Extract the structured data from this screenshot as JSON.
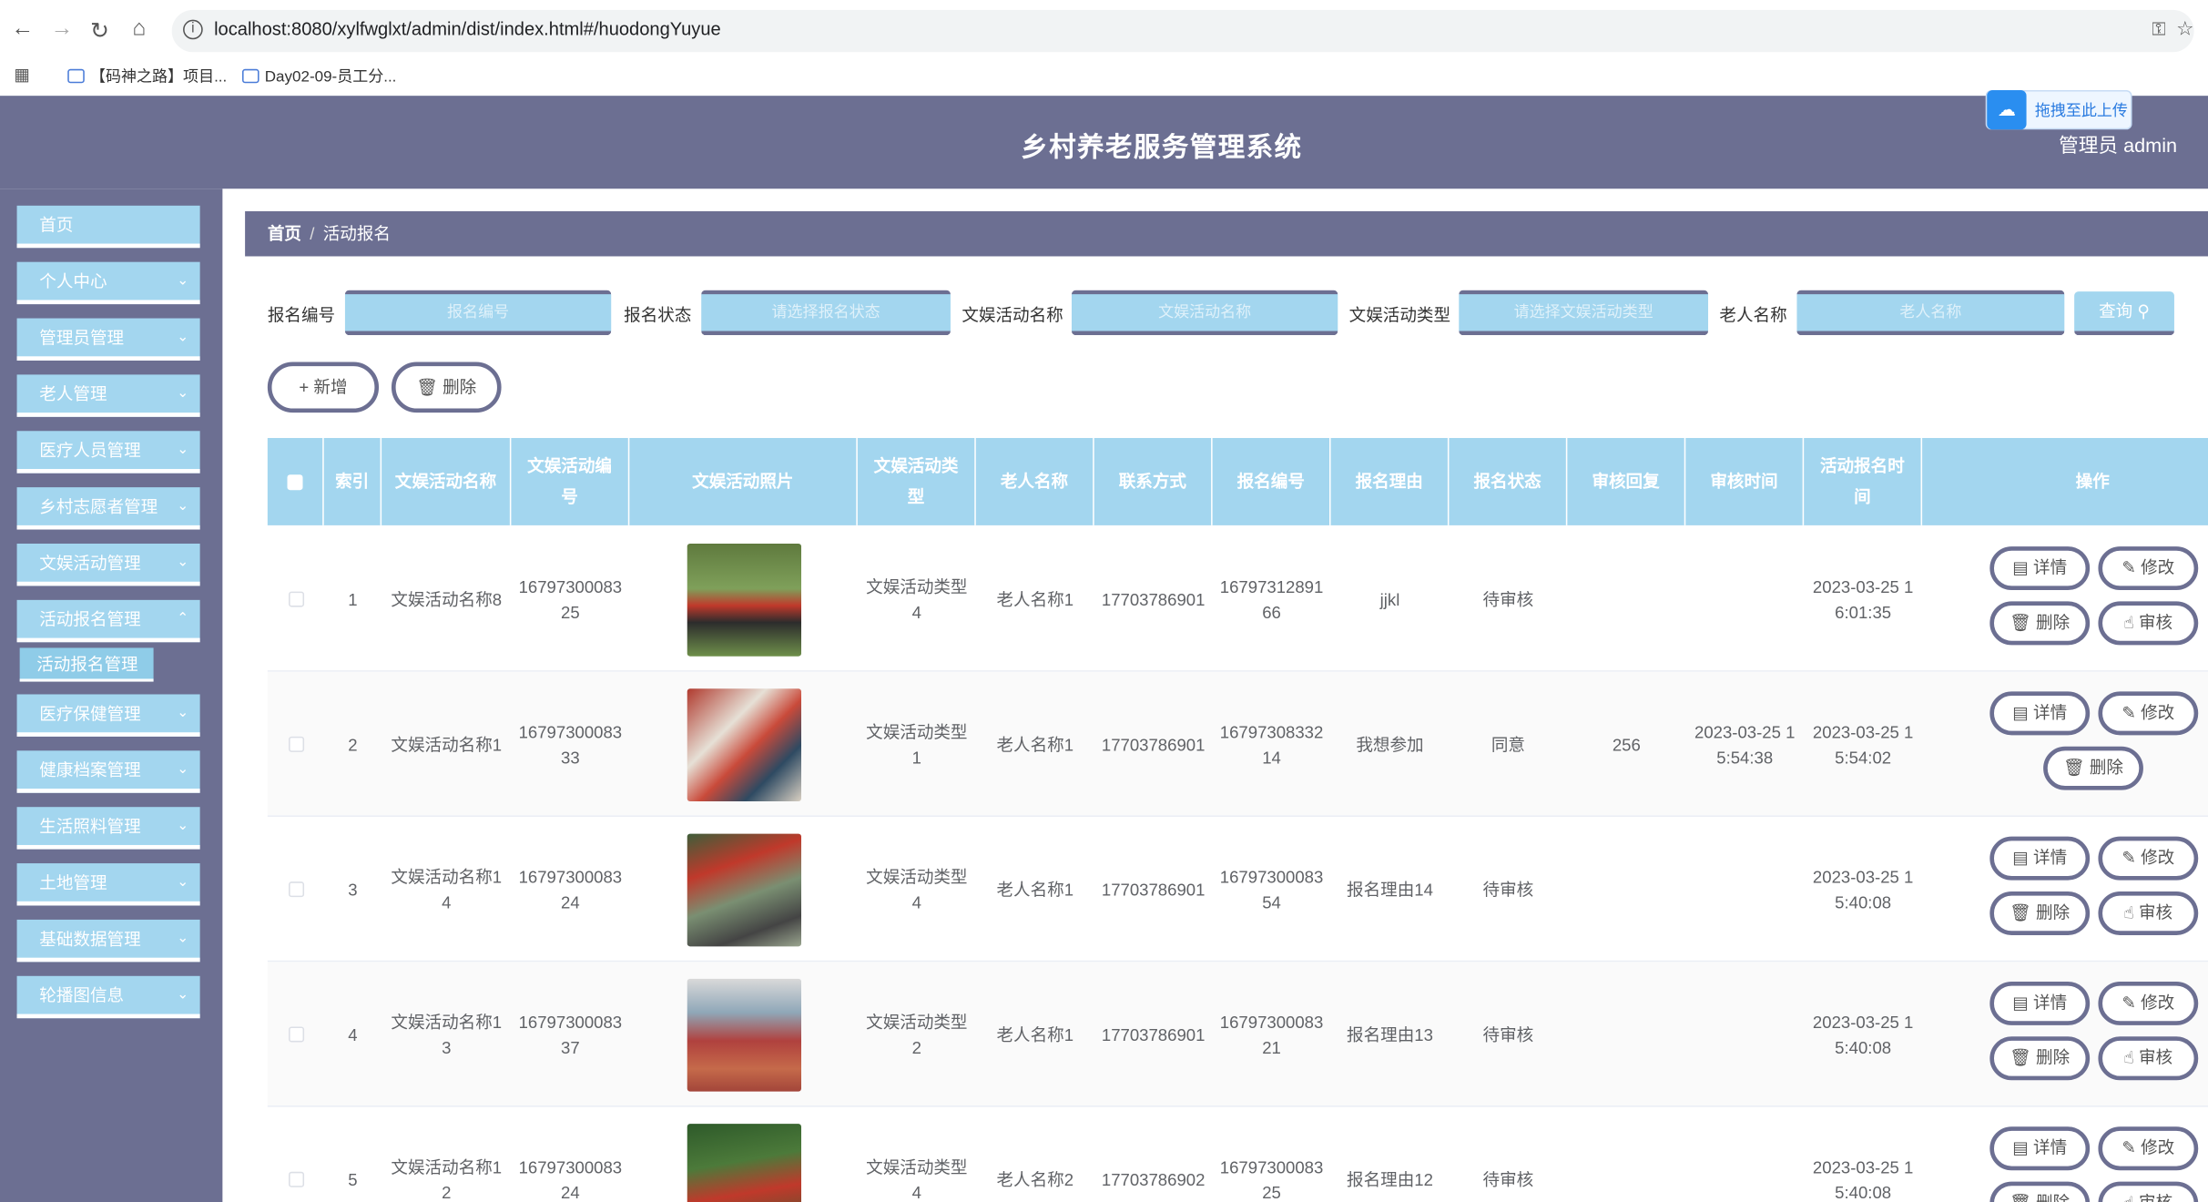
{
  "browser": {
    "url": "localhost:8080/xylfwglxt/admin/dist/index.html#/huodongYuyue",
    "bookmarks": [
      "【码神之路】项目...",
      "Day02-09-员工分..."
    ]
  },
  "header": {
    "title": "乡村养老服务管理系统",
    "user": "管理员 admin",
    "upload": "拖拽至此上传"
  },
  "sidebar": {
    "items": [
      {
        "label": "首页"
      },
      {
        "label": "个人中心"
      },
      {
        "label": "管理员管理"
      },
      {
        "label": "老人管理"
      },
      {
        "label": "医疗人员管理"
      },
      {
        "label": "乡村志愿者管理"
      },
      {
        "label": "文娱活动管理"
      },
      {
        "label": "活动报名管理"
      },
      {
        "label": "医疗保健管理"
      },
      {
        "label": "健康档案管理"
      },
      {
        "label": "生活照料管理"
      },
      {
        "label": "土地管理"
      },
      {
        "label": "基础数据管理"
      },
      {
        "label": "轮播图信息"
      }
    ],
    "sub_item": "活动报名管理"
  },
  "breadcrumb": {
    "home": "首页",
    "current": "活动报名"
  },
  "search": {
    "f1_label": "报名编号",
    "f1_ph": "报名编号",
    "f2_label": "报名状态",
    "f2_ph": "请选择报名状态",
    "f3_label": "文娱活动名称",
    "f3_ph": "文娱活动名称",
    "f4_label": "文娱活动类型",
    "f4_ph": "请选择文娱活动类型",
    "f5_label": "老人名称",
    "f5_ph": "老人名称",
    "query": "查询"
  },
  "actions": {
    "add": "新增",
    "delete": "删除"
  },
  "table": {
    "headers": [
      "索引",
      "文娱活动名称",
      "文娱活动编号",
      "文娱活动照片",
      "文娱活动类型",
      "老人名称",
      "联系方式",
      "报名编号",
      "报名理由",
      "报名状态",
      "审核回复",
      "审核时间",
      "活动报名时间",
      "操作"
    ],
    "rows": [
      {
        "idx": "1",
        "name": "文娱活动名称8",
        "code": "1679730008325",
        "type": "文娱活动类型4",
        "elder": "老人名称1",
        "phone": "17703786901",
        "no": "1679731289166",
        "reason": "jjkl",
        "status": "待审核",
        "reply": "",
        "check_time": "",
        "time": "2023-03-25 16:01:35"
      },
      {
        "idx": "2",
        "name": "文娱活动名称1",
        "code": "1679730008333",
        "type": "文娱活动类型1",
        "elder": "老人名称1",
        "phone": "17703786901",
        "no": "1679730833214",
        "reason": "我想参加",
        "status": "同意",
        "reply": "256",
        "check_time": "2023-03-25 15:54:38",
        "time": "2023-03-25 15:54:02"
      },
      {
        "idx": "3",
        "name": "文娱活动名称14",
        "code": "1679730008324",
        "type": "文娱活动类型4",
        "elder": "老人名称1",
        "phone": "17703786901",
        "no": "1679730008354",
        "reason": "报名理由14",
        "status": "待审核",
        "reply": "",
        "check_time": "",
        "time": "2023-03-25 15:40:08"
      },
      {
        "idx": "4",
        "name": "文娱活动名称13",
        "code": "1679730008337",
        "type": "文娱活动类型2",
        "elder": "老人名称1",
        "phone": "17703786901",
        "no": "1679730008321",
        "reason": "报名理由13",
        "status": "待审核",
        "reply": "",
        "check_time": "",
        "time": "2023-03-25 15:40:08"
      },
      {
        "idx": "5",
        "name": "文娱活动名称12",
        "code": "1679730008324",
        "type": "文娱活动类型4",
        "elder": "老人名称2",
        "phone": "17703786902",
        "no": "1679730008325",
        "reason": "报名理由12",
        "status": "待审核",
        "reply": "",
        "check_time": "",
        "time": "2023-03-25 15:40:08"
      }
    ],
    "ops": {
      "detail": "详情",
      "edit": "修改",
      "delete": "删除",
      "audit": "审核"
    }
  }
}
